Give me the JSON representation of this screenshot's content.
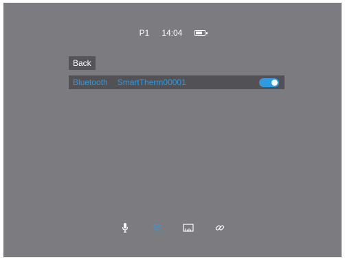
{
  "status_bar": {
    "profile": "P1",
    "time": "14:04",
    "battery_level": 0.75
  },
  "back_button": {
    "label": "Back"
  },
  "bluetooth_row": {
    "label": "Bluetooth",
    "device_name": "SmartTherm00001",
    "enabled": true
  },
  "bottom_icons": [
    "microphone-icon",
    "wifi-icon",
    "ruler-icon",
    "link-icon"
  ],
  "colors": {
    "screen_bg": "#7c7b80",
    "accent": "#2f9ae0",
    "row_bg": "#525156",
    "text": "#ffffff"
  }
}
